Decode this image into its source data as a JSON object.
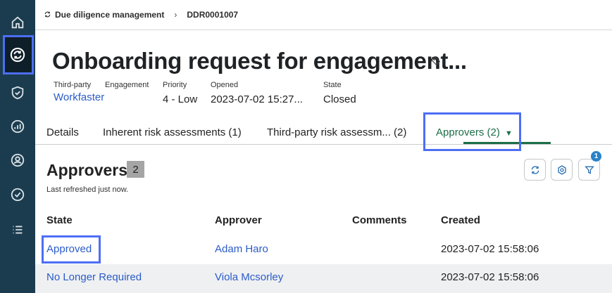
{
  "breadcrumb": {
    "items": [
      "Due diligence management",
      "DDR0001007"
    ]
  },
  "record": {
    "title": "Onboarding request for engagement...",
    "third_party_label": "Third-party",
    "third_party_value": "Workfaster",
    "engagement_label": "Engagement",
    "priority_label": "Priority",
    "priority_value": "4 - Low",
    "opened_label": "Opened",
    "opened_value": "2023-07-02 15:27...",
    "state_label": "State",
    "state_value": "Closed"
  },
  "tabs": [
    {
      "label": "Details"
    },
    {
      "label": "Inherent risk assessments (1)"
    },
    {
      "label": "Third-party risk assessm...  (2)"
    },
    {
      "label": "Approvers (2)"
    }
  ],
  "section": {
    "title": "Approvers",
    "count": "2",
    "refreshed": "Last refreshed just now.",
    "filter_count": "1"
  },
  "table": {
    "headers": [
      "State",
      "Approver",
      "Comments",
      "Created"
    ],
    "rows": [
      {
        "state": "Approved",
        "approver": "Adam Haro",
        "comments": "",
        "created": "2023-07-02 15:58:06"
      },
      {
        "state": "No Longer Required",
        "approver": "Viola Mcsorley",
        "comments": "",
        "created": "2023-07-02 15:58:06"
      }
    ]
  },
  "icons": {
    "sidebar": [
      "home-icon",
      "sync-icon",
      "shield-check-icon",
      "chart-icon",
      "settings-user-icon",
      "check-circle-icon",
      "list-icon"
    ],
    "tools": [
      "refresh-icon",
      "settings-icon",
      "filter-icon"
    ]
  },
  "colors": {
    "sidebar_bg": "#1b3c4e",
    "link": "#2b5cc8",
    "active_tab": "#1c6e48",
    "highlight": "#4d6ef5"
  }
}
